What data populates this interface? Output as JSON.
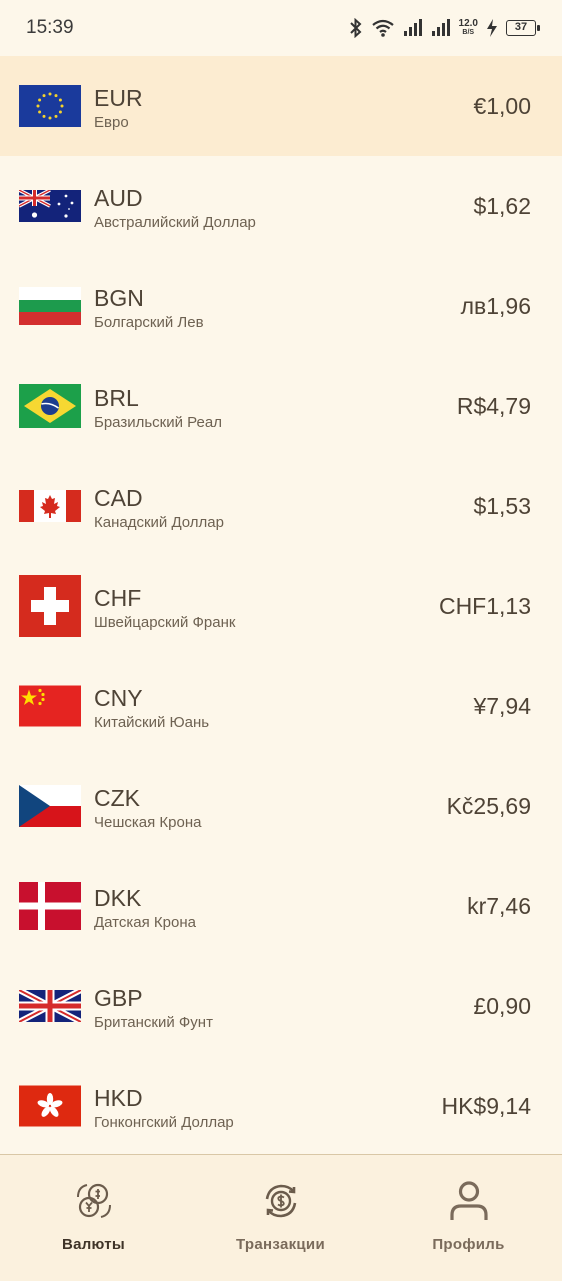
{
  "status": {
    "time": "15:39",
    "net_speed_top": "12.0",
    "net_speed_bottom": "B/S",
    "battery": "37"
  },
  "currencies": [
    {
      "code": "EUR",
      "name": "Евро",
      "rate": "€1,00",
      "flag": "eu-flag-icon",
      "selected": true
    },
    {
      "code": "AUD",
      "name": "Австралийский Доллар",
      "rate": "$1,62",
      "flag": "australia-flag-icon"
    },
    {
      "code": "BGN",
      "name": "Болгарский Лев",
      "rate": "лв1,96",
      "flag": "bulgaria-flag-icon"
    },
    {
      "code": "BRL",
      "name": "Бразильский Реал",
      "rate": "R$4,79",
      "flag": "brazil-flag-icon"
    },
    {
      "code": "CAD",
      "name": "Канадский Доллар",
      "rate": "$1,53",
      "flag": "canada-flag-icon"
    },
    {
      "code": "CHF",
      "name": "Швейцарский Франк",
      "rate": "CHF1,13",
      "flag": "switzerland-flag-icon"
    },
    {
      "code": "CNY",
      "name": "Китайский Юань",
      "rate": "¥7,94",
      "flag": "china-flag-icon"
    },
    {
      "code": "CZK",
      "name": "Чешская Крона",
      "rate": "Kč25,69",
      "flag": "czech-flag-icon"
    },
    {
      "code": "DKK",
      "name": "Датская Крона",
      "rate": "kr7,46",
      "flag": "denmark-flag-icon"
    },
    {
      "code": "GBP",
      "name": "Британский Фунт",
      "rate": "£0,90",
      "flag": "uk-flag-icon"
    },
    {
      "code": "HKD",
      "name": "Гонконгский Доллар",
      "rate": "HK$9,14",
      "flag": "hongkong-flag-icon"
    }
  ],
  "nav": [
    {
      "label": "Валюты",
      "icon": "currencies-icon",
      "active": true
    },
    {
      "label": "Транзакции",
      "icon": "transactions-icon"
    },
    {
      "label": "Профиль",
      "icon": "profile-icon"
    }
  ],
  "colors": {
    "background": "#fdf7ea",
    "selected_row": "#fcecd1",
    "text": "#4e4336",
    "nav_background": "#fbf1de"
  }
}
